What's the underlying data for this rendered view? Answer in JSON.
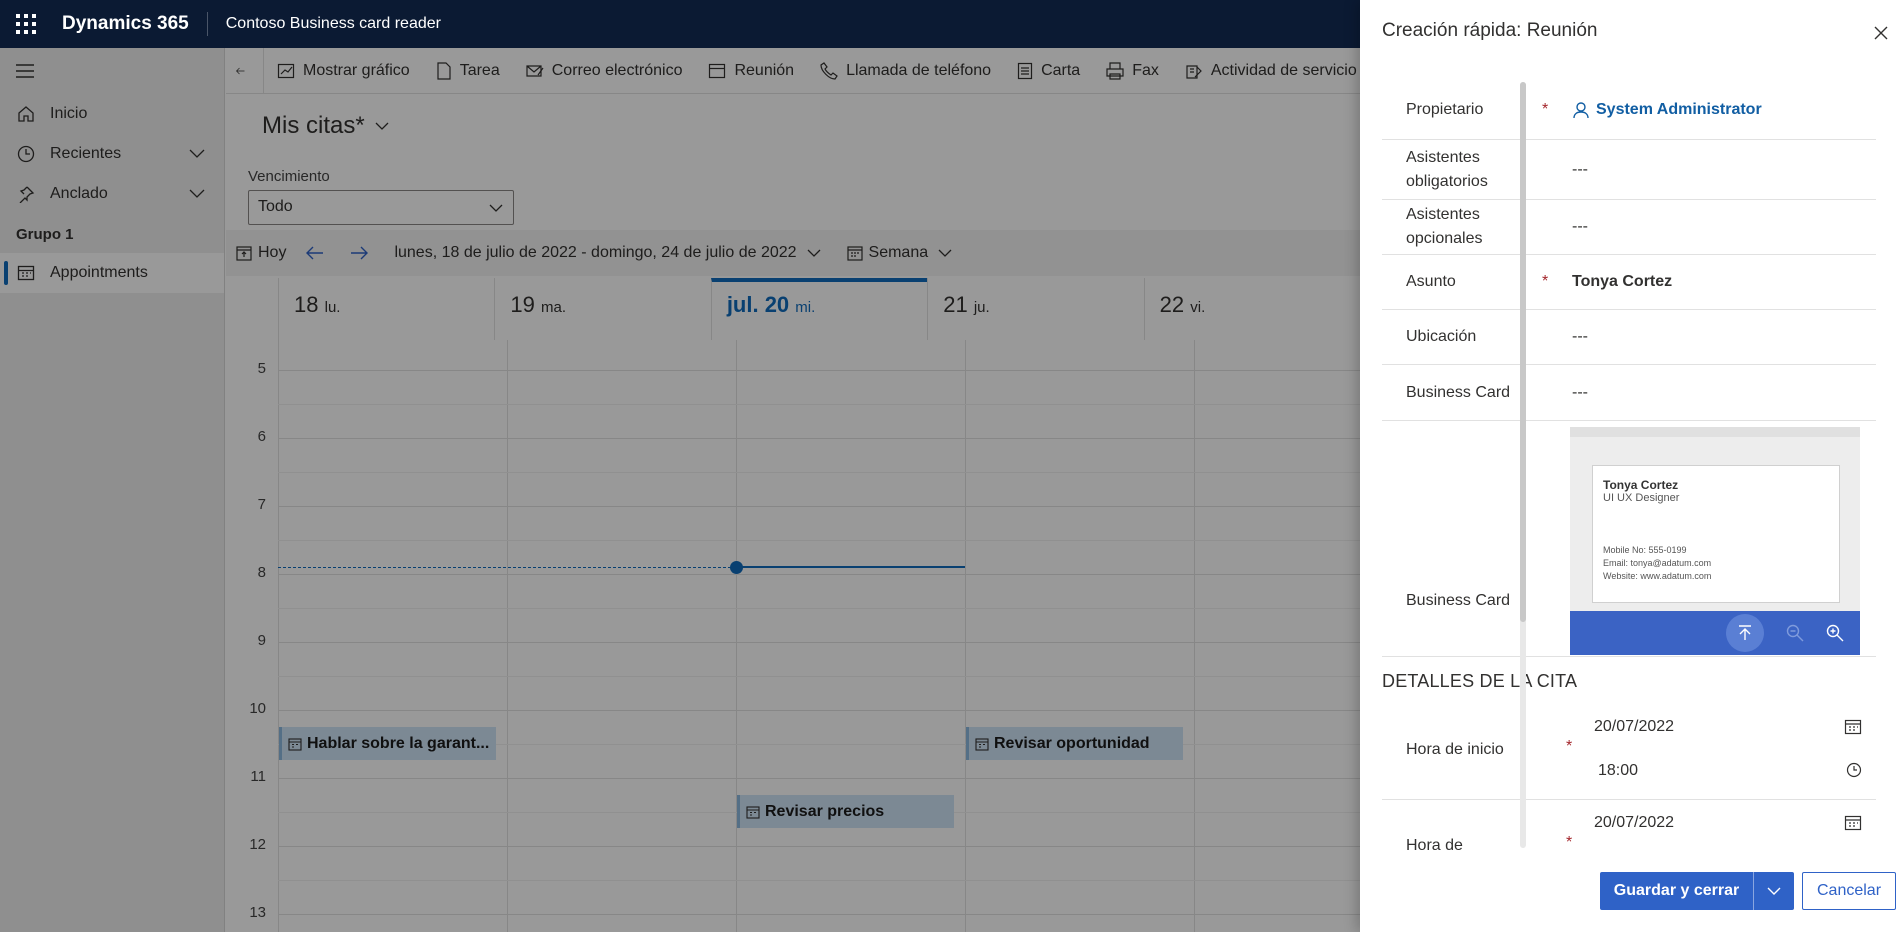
{
  "topbar": {
    "brand": "Dynamics 365",
    "app_name": "Contoso Business card reader"
  },
  "nav": {
    "items": [
      {
        "label": "Inicio",
        "icon": "home-icon"
      },
      {
        "label": "Recientes",
        "icon": "clock-icon"
      },
      {
        "label": "Anclado",
        "icon": "pin-icon"
      }
    ],
    "group": "Grupo 1",
    "entity": {
      "label": "Appointments",
      "icon": "calendar-icon"
    }
  },
  "commands": [
    {
      "label": "Mostrar gráfico",
      "icon": "chart-icon"
    },
    {
      "label": "Tarea",
      "icon": "task-icon"
    },
    {
      "label": "Correo electrónico",
      "icon": "email-icon"
    },
    {
      "label": "Reunión",
      "icon": "meeting-icon"
    },
    {
      "label": "Llamada de teléfono",
      "icon": "phone-icon"
    },
    {
      "label": "Carta",
      "icon": "letter-icon"
    },
    {
      "label": "Fax",
      "icon": "fax-icon"
    },
    {
      "label": "Actividad de servicio",
      "icon": "service-activity-icon"
    }
  ],
  "view": {
    "title": "Mis citas*",
    "filter_label": "Vencimiento",
    "filter_value": "Todo"
  },
  "calendar": {
    "today_label": "Hoy",
    "range": "lunes, 18 de julio de 2022 - domingo, 24 de julio de 2022",
    "view_mode": "Semana",
    "days": [
      {
        "num": "18",
        "name": "lu."
      },
      {
        "num": "19",
        "name": "ma."
      },
      {
        "num": "jul. 20",
        "name": "mi.",
        "today": true
      },
      {
        "num": "21",
        "name": "ju."
      },
      {
        "num": "22",
        "name": "vi."
      }
    ],
    "hours": [
      "5",
      "6",
      "7",
      "8",
      "9",
      "10",
      "11",
      "12",
      "13"
    ],
    "events": [
      {
        "title": "Hablar sobre la garant...",
        "day": 0,
        "hour": 10.25
      },
      {
        "title": "Revisar oportunidad",
        "day": 3,
        "hour": 10.25
      },
      {
        "title": "Revisar precios",
        "day": 2,
        "hour": 11.25
      }
    ],
    "now_hour": 7.9
  },
  "panel": {
    "title": "Creación rápida: Reunión",
    "fields": [
      {
        "label": "Propietario",
        "required": true,
        "value": "System Administrator",
        "type": "link"
      },
      {
        "label": "Asistentes obligatorios",
        "required": false,
        "value": "---"
      },
      {
        "label": "Asistentes opcionales",
        "required": false,
        "value": "---"
      },
      {
        "label": "Asunto",
        "required": true,
        "value": "Tonya Cortez",
        "type": "bold"
      },
      {
        "label": "Ubicación",
        "required": false,
        "value": "---"
      },
      {
        "label": "Business Card",
        "required": false,
        "value": "---"
      }
    ],
    "card_field_label": "Business Card",
    "card": {
      "name": "Tonya Cortez",
      "title": "UI UX Designer",
      "mobile": "Mobile No: 555-0199",
      "email": "Email: tonya@adatum.com",
      "website": "Website: www.adatum.com"
    },
    "section": "DETALLES DE LA CITA",
    "start": {
      "label": "Hora de inicio",
      "date": "20/07/2022",
      "time": "18:00"
    },
    "end": {
      "label": "Hora de finalización",
      "date": "20/07/2022"
    },
    "save_label": "Guardar y cerrar",
    "cancel_label": "Cancelar"
  },
  "required_mark": "*"
}
